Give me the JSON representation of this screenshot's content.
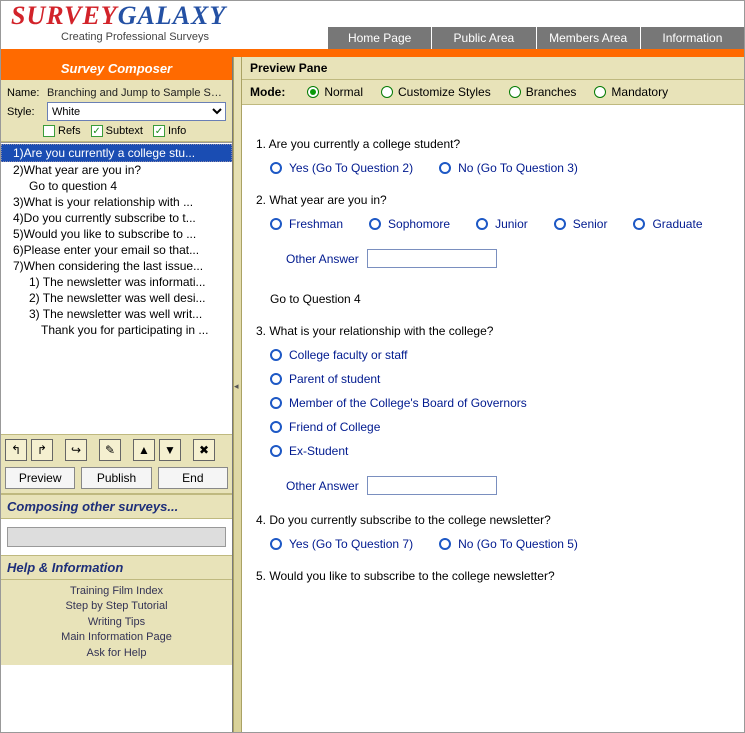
{
  "brand": {
    "part1": "SURVEY",
    "part2": "GALAXY",
    "tagline": "Creating Professional Surveys"
  },
  "topnav": [
    "Home Page",
    "Public Area",
    "Members Area",
    "Information"
  ],
  "sidebar": {
    "title": "Survey Composer",
    "name_lbl": "Name:",
    "name_val": "Branching and Jump to Sample Su...",
    "style_lbl": "Style:",
    "style_val": "White",
    "checks": {
      "refs": "Refs",
      "subtext": "Subtext",
      "info": "Info"
    },
    "tree": [
      "1)Are you currently a college stu...",
      "2)What year are you in?",
      "Go to question 4",
      "3)What is your relationship with ...",
      "4)Do you currently subscribe to t...",
      "5)Would you like to subscribe to ...",
      "6)Please enter your email so that...",
      "7)When considering the last issue...",
      "1) The newsletter was informati...",
      "2) The newsletter was well desi...",
      "3) The newsletter was well writ...",
      "Thank you for participating in ..."
    ],
    "buttons": {
      "preview": "Preview",
      "publish": "Publish",
      "end": "End"
    },
    "composing_h": "Composing other surveys...",
    "help_h": "Help & Information",
    "help_links": [
      "Training Film Index",
      "Step by Step Tutorial",
      "Writing Tips",
      "Main Information Page",
      "Ask for Help"
    ]
  },
  "preview": {
    "pane_title": "Preview Pane",
    "mode_label": "Mode:",
    "modes": [
      "Normal",
      "Customize Styles",
      "Branches",
      "Mandatory"
    ],
    "q1": {
      "text": "1. Are you currently a college student?",
      "opts": [
        "Yes (Go To Question 2)",
        "No (Go To Question 3)"
      ]
    },
    "q2": {
      "text": "2. What year are you in?",
      "opts": [
        "Freshman",
        "Sophomore",
        "Junior",
        "Senior",
        "Graduate"
      ],
      "other": "Other Answer",
      "goto": "Go to Question 4"
    },
    "q3": {
      "text": "3. What is your relationship with the college?",
      "opts": [
        "College faculty or staff",
        "Parent of student",
        "Member of the College's Board of Governors",
        "Friend of College",
        "Ex-Student"
      ],
      "other": "Other Answer"
    },
    "q4": {
      "text": "4. Do you currently subscribe to the college newsletter?",
      "opts": [
        "Yes (Go To Question 7)",
        "No (Go To Question 5)"
      ]
    },
    "q5": {
      "text": "5. Would you like to subscribe to the college newsletter?"
    }
  }
}
